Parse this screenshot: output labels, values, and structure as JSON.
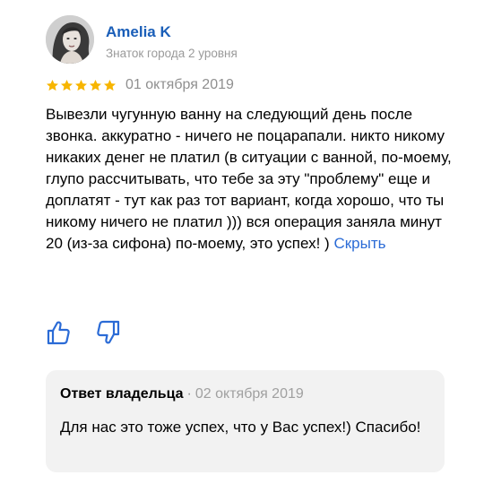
{
  "author": {
    "name": "Amelia K",
    "level": "Знаток города 2 уровня"
  },
  "review": {
    "rating": 5,
    "rating_max": 5,
    "star_color": "#f7b500",
    "date": "01 октября 2019",
    "text": "Вывезли чугунную ванну на следующий день после звонка. аккуратно - ничего не поцарапали. никто никому никаких денег не платил (в ситуации с ванной, по-моему, глупо рассчитывать, что тебе за эту \"проблему\" еще и доплатят - тут как раз тот вариант, когда хорошо, что ты никому ничего не платил ))) вся операция заняла минут 20 (из-за сифона) по-моему, это успех! )",
    "hide_label": "Скрыть"
  },
  "reactions": {
    "like_icon": "thumbs-up-icon",
    "dislike_icon": "thumbs-down-icon",
    "color": "#2b6bd6"
  },
  "owner_reply": {
    "title": "Ответ владельца",
    "separator": "·",
    "date": "02 октября 2019",
    "text": "Для нас это тоже успех, что у Вас успех!) Спасибо!"
  }
}
